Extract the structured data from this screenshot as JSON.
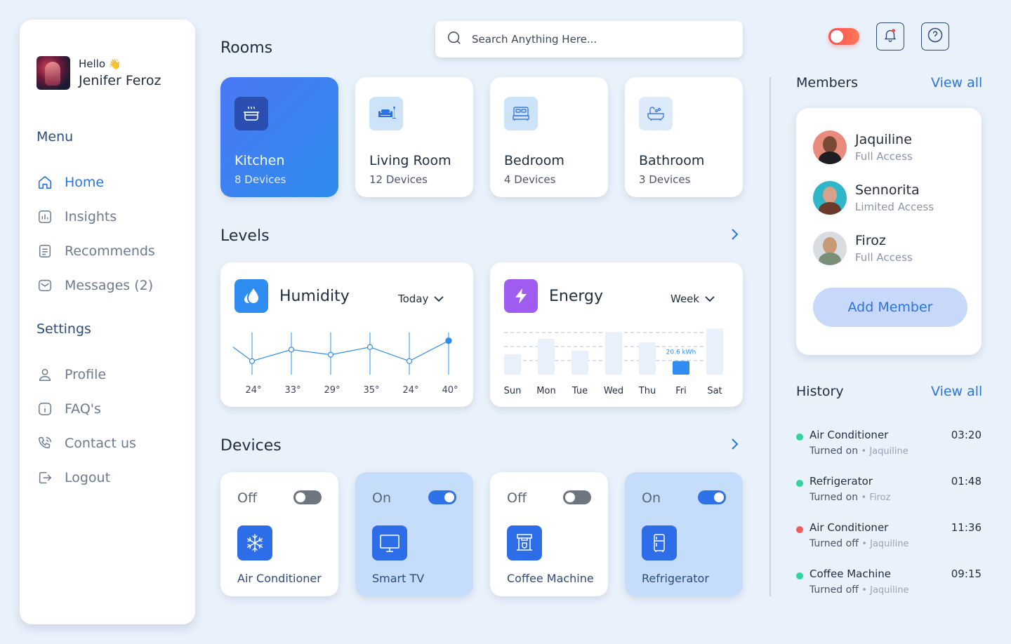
{
  "user": {
    "greeting": "Hello",
    "wave": "👋",
    "name": "Jenifer Feroz"
  },
  "sidebar": {
    "menu_label": "Menu",
    "menu": [
      {
        "label": "Home",
        "icon": "home-icon",
        "active": true
      },
      {
        "label": "Insights",
        "icon": "insights-icon"
      },
      {
        "label": "Recommends",
        "icon": "recommends-icon"
      },
      {
        "label": "Messages (2)",
        "icon": "mail-icon"
      }
    ],
    "settings_label": "Settings",
    "settings": [
      {
        "label": "Profile",
        "icon": "user-icon"
      },
      {
        "label": "FAQ's",
        "icon": "info-icon"
      },
      {
        "label": "Contact us",
        "icon": "phone-icon"
      },
      {
        "label": "Logout",
        "icon": "logout-icon"
      }
    ]
  },
  "search": {
    "placeholder": "Search Anything Here..."
  },
  "rooms": {
    "title": "Rooms",
    "items": [
      {
        "name": "Kitchen",
        "devices": "8 Devices",
        "icon": "cooking-pot-icon",
        "active": true
      },
      {
        "name": "Living Room",
        "devices": "12 Devices",
        "icon": "sofa-icon"
      },
      {
        "name": "Bedroom",
        "devices": "4 Devices",
        "icon": "bed-icon"
      },
      {
        "name": "Bathroom",
        "devices": "3 Devices",
        "icon": "bathtub-icon"
      }
    ]
  },
  "levels": {
    "title": "Levels",
    "humidity": {
      "title": "Humidity",
      "period": "Today",
      "icon": "water-drop-icon",
      "color": "#2f8cf0"
    },
    "energy": {
      "title": "Energy",
      "period": "Week",
      "icon": "lightning-icon",
      "color": "#a05cf0"
    }
  },
  "chart_data": [
    {
      "type": "line",
      "title": "Humidity",
      "categories": [
        "24°",
        "33°",
        "29°",
        "35°",
        "24°",
        "40°"
      ],
      "values": [
        24,
        33,
        29,
        35,
        24,
        40
      ],
      "grid": false
    },
    {
      "type": "bar",
      "title": "Energy",
      "categories": [
        "Sun",
        "Mon",
        "Tue",
        "Wed",
        "Thu",
        "Fri",
        "Sat"
      ],
      "values": [
        12,
        21,
        14,
        25,
        19,
        8,
        27
      ],
      "highlight": {
        "category": "Fri",
        "label": "20.6 kWh"
      },
      "grid": true
    }
  ],
  "devices": {
    "title": "Devices",
    "items": [
      {
        "name": "Air Conditioner",
        "state": "Off",
        "on": false,
        "icon": "snowflake-icon"
      },
      {
        "name": "Smart TV",
        "state": "On",
        "on": true,
        "icon": "tv-icon"
      },
      {
        "name": "Coffee Machine",
        "state": "Off",
        "on": false,
        "icon": "coffee-machine-icon"
      },
      {
        "name": "Refrigerator",
        "state": "On",
        "on": true,
        "icon": "refrigerator-icon"
      }
    ]
  },
  "members": {
    "title": "Members",
    "view_all": "View all",
    "items": [
      {
        "name": "Jaquiline",
        "role": "Full Access"
      },
      {
        "name": "Sennorita",
        "role": "Limited Access"
      },
      {
        "name": "Firoz",
        "role": "Full Access"
      }
    ],
    "add_label": "Add Member"
  },
  "history": {
    "title": "History",
    "view_all": "View all",
    "items": [
      {
        "device": "Air Conditioner",
        "time": "03:20",
        "action": "Turned on",
        "by": "Jaquiline",
        "status_color": "#2fd4a0"
      },
      {
        "device": "Refrigerator",
        "time": "01:48",
        "action": "Turned on",
        "by": "Firoz",
        "status_color": "#2fd4a0"
      },
      {
        "device": "Air Conditioner",
        "time": "11:36",
        "action": "Turned off",
        "by": "Jaquiline",
        "status_color": "#f25c5c"
      },
      {
        "device": "Coffee Machine",
        "time": "09:15",
        "action": "Turned off",
        "by": "Jaquiline",
        "status_color": "#2fd4a0"
      }
    ]
  }
}
